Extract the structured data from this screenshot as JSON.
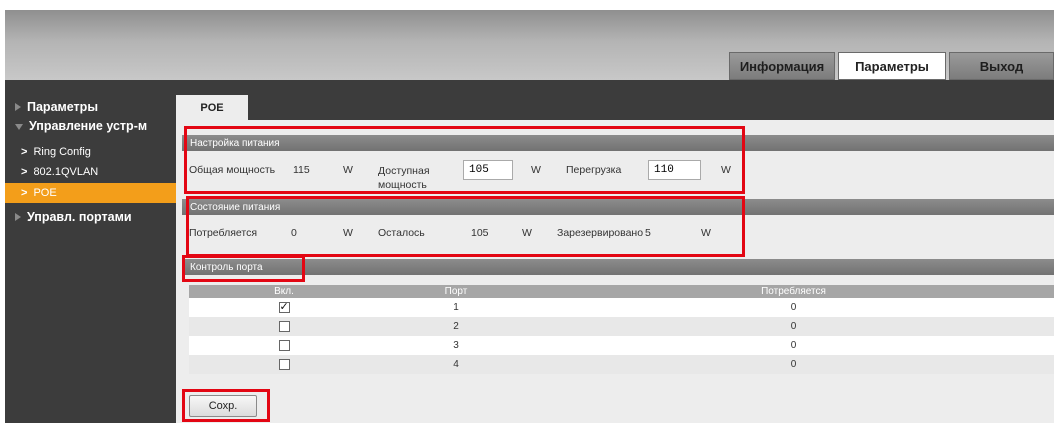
{
  "header": {
    "tabs": [
      {
        "label": "Информация",
        "active": false
      },
      {
        "label": "Параметры",
        "active": true
      },
      {
        "label": "Выход",
        "active": false
      }
    ]
  },
  "sidebar": {
    "items": [
      {
        "label": "Параметры",
        "level": 0,
        "expanded": false
      },
      {
        "label": "Управление устр-м",
        "level": 0,
        "expanded": true
      },
      {
        "label": "Ring Config",
        "level": 1
      },
      {
        "label": "802.1QVLAN",
        "level": 1
      },
      {
        "label": "POE",
        "level": 1,
        "selected": true
      },
      {
        "label": "Управл. портами",
        "level": 0,
        "expanded": false
      }
    ]
  },
  "main": {
    "tab_label": "POE",
    "power_settings": {
      "title": "Настройка питания",
      "total_label": "Общая мощность",
      "total_value": "115",
      "total_unit": "W",
      "available_label": "Доступная мощность",
      "available_value": "105",
      "available_unit": "W",
      "overload_label": "Перегрузка",
      "overload_value": "110",
      "overload_unit": "W"
    },
    "power_status": {
      "title": "Состояние питания",
      "consumed_label": "Потребляется",
      "consumed_value": "0",
      "consumed_unit": "W",
      "remaining_label": "Осталось",
      "remaining_value": "105",
      "remaining_unit": "W",
      "reserved_label": "Зарезервировано",
      "reserved_value": "5",
      "reserved_unit": "W"
    },
    "port_control": {
      "title": "Контроль порта",
      "columns": [
        "Вкл.",
        "Порт",
        "Потребляется"
      ],
      "rows": [
        {
          "enabled": true,
          "port": "1",
          "consumed": "0"
        },
        {
          "enabled": false,
          "port": "2",
          "consumed": "0"
        },
        {
          "enabled": false,
          "port": "3",
          "consumed": "0"
        },
        {
          "enabled": false,
          "port": "4",
          "consumed": "0"
        }
      ]
    },
    "save_label": "Сохр."
  },
  "colors": {
    "highlight_border": "#e30613",
    "nav_selected": "#f39e1a",
    "dark_panel": "#3c3c3c"
  }
}
